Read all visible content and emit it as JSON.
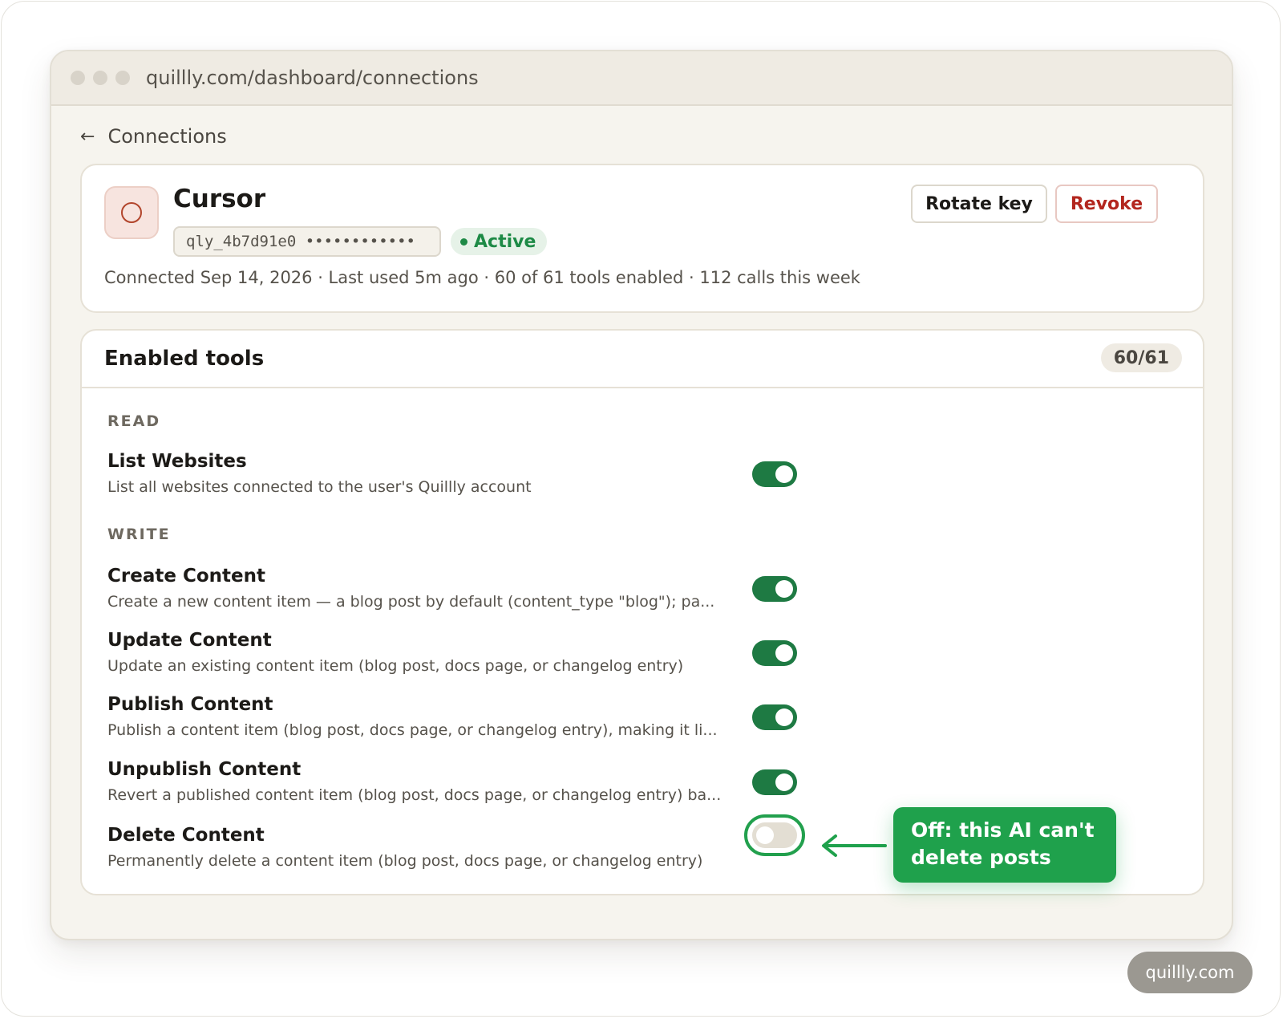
{
  "browser": {
    "url": "quillly.com/dashboard/connections"
  },
  "breadcrumb": {
    "back_label": "Connections"
  },
  "connection": {
    "name": "Cursor",
    "api_key": "qly_4b7d91e0 ••••••••••••",
    "status": "Active",
    "meta": "Connected Sep 14, 2026 · Last used 5m ago · 60 of 61 tools enabled · 112 calls this week",
    "rotate_label": "Rotate key",
    "revoke_label": "Revoke"
  },
  "tools": {
    "title": "Enabled tools",
    "count": "60/61",
    "groups": [
      {
        "label": "READ",
        "items": [
          {
            "name": "List Websites",
            "description": "List all websites connected to the user's Quillly account",
            "enabled": true
          }
        ]
      },
      {
        "label": "WRITE",
        "items": [
          {
            "name": "Create Content",
            "description": "Create a new content item — a blog post by default (content_type \"blog\"); pa...",
            "enabled": true
          },
          {
            "name": "Update Content",
            "description": "Update an existing content item (blog post, docs page, or changelog entry)",
            "enabled": true
          },
          {
            "name": "Publish Content",
            "description": "Publish a content item (blog post, docs page, or changelog entry), making it li...",
            "enabled": true
          },
          {
            "name": "Unpublish Content",
            "description": "Revert a published content item (blog post, docs page, or changelog entry) ba...",
            "enabled": true
          },
          {
            "name": "Delete Content",
            "description": "Permanently delete a content item (blog post, docs page, or changelog entry)",
            "enabled": false
          }
        ]
      }
    ]
  },
  "callout": {
    "text": "Off: this AI can't delete posts"
  },
  "footer": {
    "brand": "quillly.com"
  },
  "colors": {
    "accent_green": "#1e7a43",
    "callout_green": "#1fa14c",
    "revoke_red": "#b3261e",
    "background": "#f6f4ee"
  }
}
